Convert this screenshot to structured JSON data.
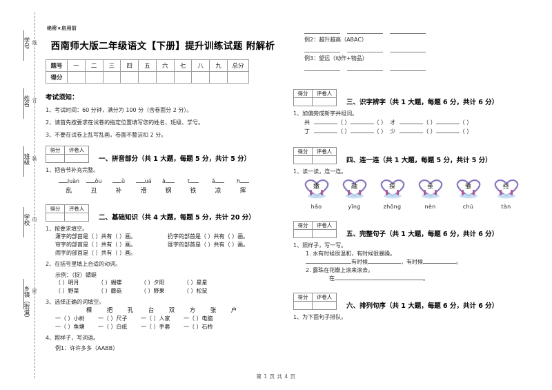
{
  "document": {
    "secret_notice": "绝密★启用前",
    "title": "西南师大版二年级语文【下册】提升训练试题 附解析",
    "footer": "第 1 页 共 4 页"
  },
  "seal_margin": {
    "labels": [
      {
        "main": "学号",
        "sub": "线"
      },
      {
        "main": "姓名",
        "sub": "订"
      },
      {
        "main": "班级",
        "sub": "装"
      },
      {
        "main": "学校",
        "sub": "内"
      },
      {
        "main": "乡镇（街道）",
        "sub": "密"
      }
    ]
  },
  "score_table": {
    "headers": [
      "题号",
      "一",
      "二",
      "三",
      "四",
      "五",
      "六",
      "七",
      "八",
      "九",
      "总分"
    ],
    "row_label": "得分",
    "values": [
      "",
      "",
      "",
      "",
      "",
      "",
      "",
      "",
      "",
      ""
    ]
  },
  "notice": {
    "title": "考试须知：",
    "items": [
      "1、考试时间：60 分钟，满分为 100 分（含卷面分 2 分）。",
      "2、请首先按要求在试卷的指定位置填写您的姓名、班级、学号。",
      "3、不要在试卷上乱写乱画，卷面不整洁扣 2 分。"
    ]
  },
  "score_box": {
    "score_label": "得分",
    "grader_label": "评卷人"
  },
  "sections": {
    "s1": {
      "title": "一、拼音部分（共 1 大题，每题 5 分，共计 5 分）",
      "q1": "1、把音节补充完整。",
      "pinyin": [
        "luàn",
        "ǒu",
        "ǔ",
        "uá",
        "ā",
        "t",
        "ǎ",
        "h"
      ],
      "hanzi": [
        "乱",
        "丑",
        "补",
        "滑",
        "钢",
        "铁",
        "凉",
        "挥"
      ]
    },
    "s2": {
      "title": "二、基础知识（共 4 大题，每题 5 分，共计 20 分）",
      "q1": "1、按要求填空。",
      "radicals": [
        {
          "left": "潇字的部首是（     ）共有（     ）画。",
          "right": "扔字的部首是（     ）共有（     ）画。"
        },
        {
          "left": "帘字的部首是（     ）共有（     ）画。",
          "right": "匪字的部首是（     ）共有（     ）画。"
        },
        {
          "left": "闹字的部首是（     ）共有（     ）画。",
          "right": ""
        }
      ],
      "q2": "2、在括号里填上合适的动词。",
      "q2_example": "示例：（捉）蜻蜓",
      "verbs_row1": [
        "（     ）明月",
        "（     ）蝴蝶",
        "（     ）夕阳",
        "（     ）星星"
      ],
      "verbs_row2": [
        "（     ）野菜",
        "（     ）蘑菇",
        "（     ）野果",
        "（     ）松鼠"
      ],
      "q3": "3、选择正确的词填空。",
      "measure_words": [
        "棵",
        "把",
        "孔",
        "台",
        "双",
        "方",
        "张",
        "户"
      ],
      "mw_row1": [
        "一（     ）小树",
        "一（     ）尺子",
        "一（     ）人家",
        "一（     ）电脑"
      ],
      "mw_row2": [
        "一（     ）鱼塘",
        "一（     ）白纸",
        "一（     ）手套",
        "一（     ）石桥"
      ],
      "q4": "4、照样子，写词语。",
      "examples": [
        "例1：许许多多（AABB）",
        "例2：越升越高（ABAC）",
        "例3：望远（动作+物品）"
      ]
    },
    "s3": {
      "title": "三、识字辨字（共 1 大题，每题 6 分，共计 6 分）",
      "q1": "1、加偏旁成新字并组词。",
      "rows": [
        {
          "seed": "共",
          "tail": "（     ）"
        },
        {
          "seed": "丁",
          "tail": "（     ）"
        },
        {
          "seed": "才",
          "tail": "（     ）"
        },
        {
          "seed": "少",
          "tail": "（     ）"
        }
      ]
    },
    "s4": {
      "title": "四、连一连（共 1 大题，每题 5 分，共计 5 分）",
      "q1": "1、读一读，连一连。",
      "hearts": [
        "嫩",
        "融",
        "探",
        "亲",
        "雏",
        "终"
      ],
      "pinyin": [
        "hǎo",
        "yīng",
        "zhōng",
        "nèn",
        "chú",
        "tàn"
      ]
    },
    "s5": {
      "title": "五、完整句子（共 1 大题，每题 6 分，共计 6 分）",
      "q1": "1、照样子，写一写。",
      "ex1": "1. 水有时候很温和，有时候很暴躁。",
      "ex1_blank_a": "有时候",
      "ex1_blank_b": "，有时候",
      "ex2": "2. 露珠在花瓣上滚来滚去。",
      "ex2_blank": "在"
    },
    "s6": {
      "title": "六、排列句序（共 1 大题，每题 6 分，共计 6 分）",
      "q1": "1、为下面句子排队。"
    }
  },
  "colors": {
    "heart_outline": "#7f6fb5",
    "heart_accent": "#b36a9e",
    "ink": "#1a1a1a",
    "rule": "#8f8f8f"
  }
}
